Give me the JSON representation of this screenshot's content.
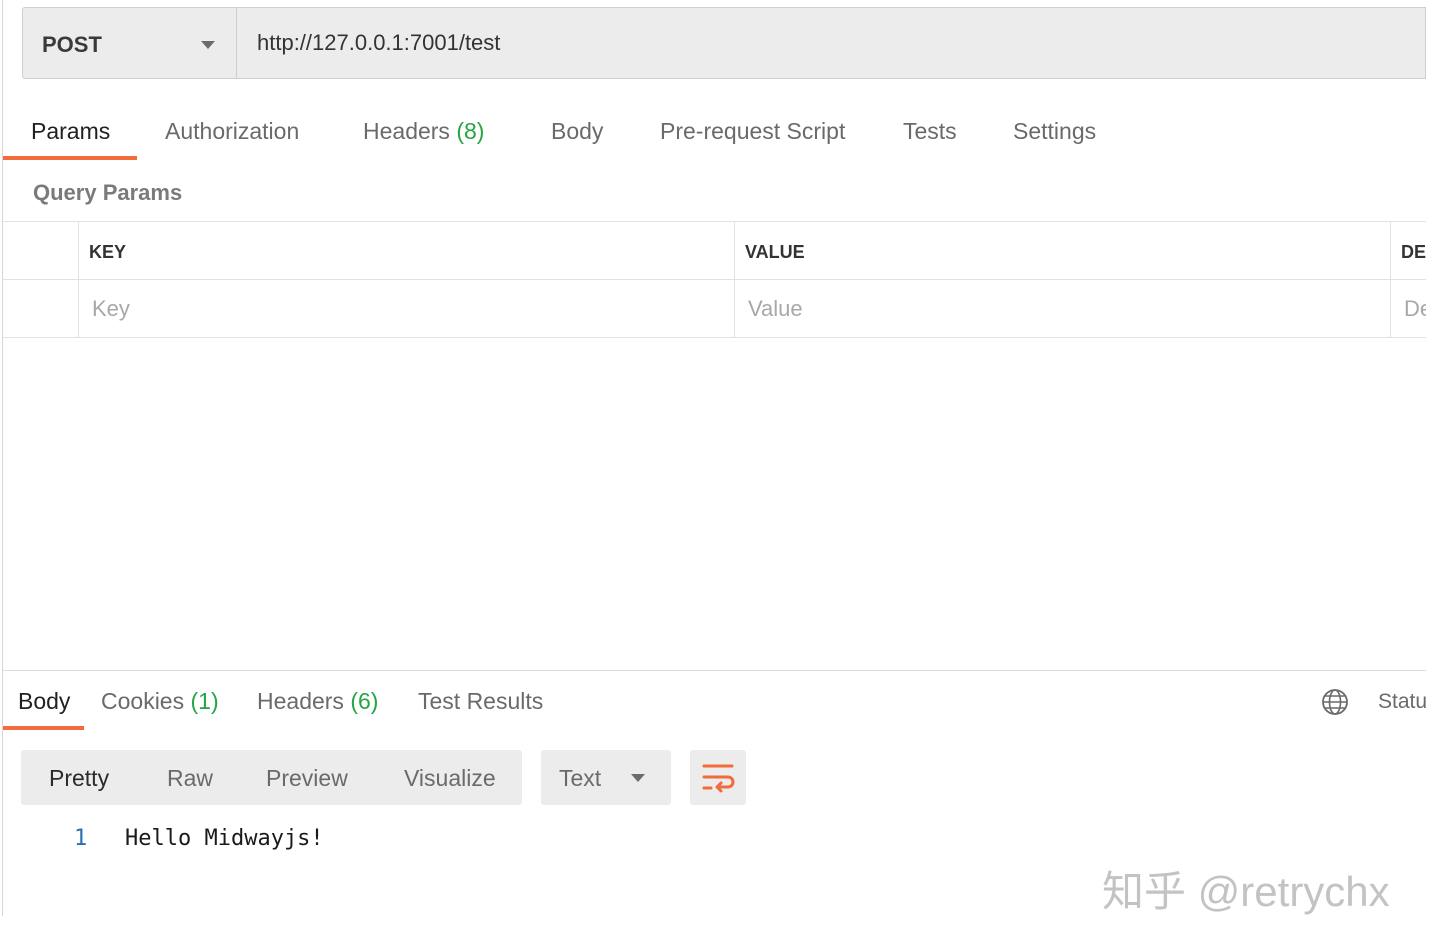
{
  "request": {
    "method": "POST",
    "url": "http://127.0.0.1:7001/test"
  },
  "request_tabs": [
    {
      "label": "Params",
      "count": ""
    },
    {
      "label": "Authorization",
      "count": ""
    },
    {
      "label": "Headers",
      "count": "(8)"
    },
    {
      "label": "Body",
      "count": ""
    },
    {
      "label": "Pre-request Script",
      "count": ""
    },
    {
      "label": "Tests",
      "count": ""
    },
    {
      "label": "Settings",
      "count": ""
    }
  ],
  "query_params": {
    "title": "Query Params",
    "columns": [
      "KEY",
      "VALUE",
      "DE"
    ],
    "placeholders": [
      "Key",
      "Value",
      "De"
    ]
  },
  "response": {
    "tabs": [
      {
        "label": "Body",
        "count": ""
      },
      {
        "label": "Cookies",
        "count": "(1)"
      },
      {
        "label": "Headers",
        "count": "(6)"
      },
      {
        "label": "Test Results",
        "count": ""
      }
    ],
    "status_label": "Statu",
    "view_modes": [
      "Pretty",
      "Raw",
      "Preview",
      "Visualize"
    ],
    "format": "Text",
    "line_number": "1",
    "body_text": "Hello Midwayjs!"
  },
  "watermark": "知乎 @retrychx",
  "colors": {
    "accent": "#f26b3a",
    "count": "#26a544",
    "line_number": "#2a6fb5"
  },
  "icons": [
    "chevron-down-icon",
    "globe-icon",
    "wrap-lines-icon"
  ]
}
